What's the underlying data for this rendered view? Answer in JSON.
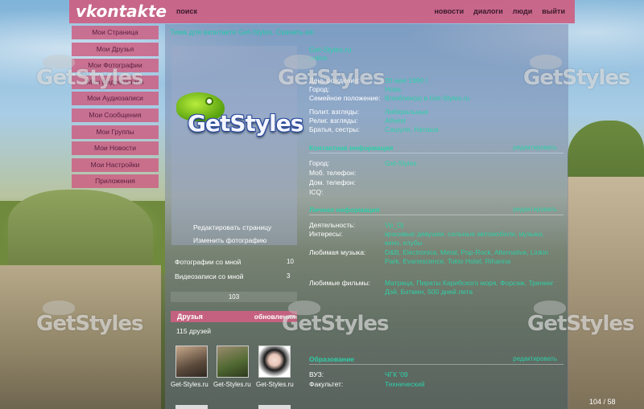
{
  "app": {
    "logo": "vkontakte",
    "search": "поиск",
    "nav": [
      "новости",
      "диалоги",
      "люди",
      "выйти"
    ]
  },
  "sidebar": {
    "items": [
      {
        "label": "Мои Страница"
      },
      {
        "label": "Мои Друзья"
      },
      {
        "label": "Мои Фотографии"
      },
      {
        "label": "Мои Видеозаписи"
      },
      {
        "label": "Мои Аудиозаписи"
      },
      {
        "label": "Мои Сообщения"
      },
      {
        "label": "Мои Группы"
      },
      {
        "label": "Мои Новости"
      },
      {
        "label": "Мои Настройки"
      },
      {
        "label": "Приложения"
      }
    ]
  },
  "profile": {
    "status": "Тема для вконтакте Get-Styles. Скачать её.",
    "name": "Get-Styles.ru",
    "name_sub": "online",
    "photo_logo": "GetStyles",
    "actions": {
      "edit_page": "Редактировать страницу",
      "change_photo": "Изменить фотографию"
    },
    "photos_with_me": {
      "label": "Фотографии со мной",
      "count": "10"
    },
    "videos_with_me": {
      "label": "Видеозаписи со мной",
      "count": "3"
    },
    "bar_value": "103",
    "info": [
      {
        "k": "День рождения:",
        "v": "20 мая 1990 г."
      },
      {
        "k": "Город:",
        "v": "Нова"
      },
      {
        "k": "Семейное положение:",
        "v": "Влюблен(а) в Get-Styles.ru"
      },
      {
        "k": "Полит. взгляды:",
        "v": "Либеральные"
      },
      {
        "k": "Религ. взгляды:",
        "v": "Atheist"
      },
      {
        "k": "Братья, сестры:",
        "v": "Сашуля, Наташа"
      }
    ],
    "contacts_section": {
      "title": "Контактная информация",
      "edit": "редактировать"
    },
    "contacts": [
      {
        "k": "Город:",
        "v": "Get-Styles"
      },
      {
        "k": "Моб. телефон:",
        "v": ""
      },
      {
        "k": "Дом. телефон:",
        "v": ""
      },
      {
        "k": "ICQ:",
        "v": ""
      }
    ],
    "personal_section": {
      "title": "Личная информация",
      "edit": "редактировать"
    },
    "personal": [
      {
        "k": "Деятельность:",
        "v": "Vp_Dj"
      },
      {
        "k": "Интересы:",
        "v": "красивые девушки, сильные автомобили, музыка, кино, клубы"
      },
      {
        "k": "Любимая музыка:",
        "v": "D&B, Electronica, Metal, Pop-Rock, Alternative, Linkin Park, Evanescence, Tokio Hotel, Rihanna"
      },
      {
        "k": "Любимые фильмы:",
        "v": "Матрица, Пираты Карибского моря, Форсаж, Тренинг Дэй, Бэтмен, 500 дней лета"
      }
    ],
    "friends": {
      "title": "Друзья",
      "updates": "обновления",
      "count": "115 друзей",
      "captions": [
        "Get-Styles.ru",
        "Get-Styles.ru",
        "Get-Styles.ru"
      ]
    },
    "education_section": {
      "title": "Образование",
      "edit": "редактировать"
    },
    "education": [
      {
        "k": "ВУЗ:",
        "v": "ЧГК '09"
      },
      {
        "k": "Факультет:",
        "v": "Технический"
      }
    ]
  },
  "footer": {
    "page_count": "104 / 58"
  }
}
